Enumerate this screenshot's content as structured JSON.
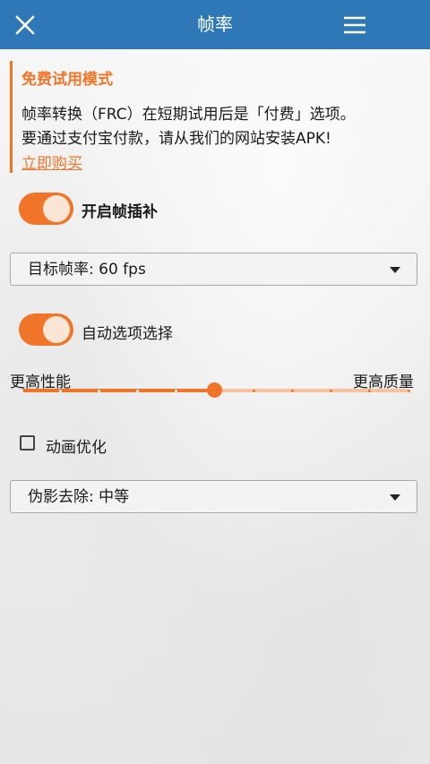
{
  "header": {
    "title": "帧率",
    "close_icon": "close-icon",
    "menu_icon": "hamburger-menu-icon"
  },
  "trial_notice": {
    "title": "免费试用模式",
    "line1": "帧率转换（FRC）在短期试用后是「付费」选项。",
    "line2": "要通过支付宝付款，请从我们的网站安装APK!",
    "link": "立即购买"
  },
  "frame_interpolation": {
    "label": "开启帧插补",
    "enabled": true
  },
  "target_fps": {
    "value": "目标帧率: 60 fps"
  },
  "auto_option": {
    "label": "自动选项选择",
    "enabled": true
  },
  "quality_slider": {
    "left_label": "更高性能",
    "right_label": "更高质量",
    "position": 0.5,
    "steps": 11
  },
  "animation_optimize": {
    "label": "动画优化",
    "checked": false
  },
  "artifact_removal": {
    "value": "伪影去除: 中等"
  },
  "colors": {
    "header": "#2f78b7",
    "accent": "#f07528",
    "accent_light": "#f6c3a0"
  }
}
